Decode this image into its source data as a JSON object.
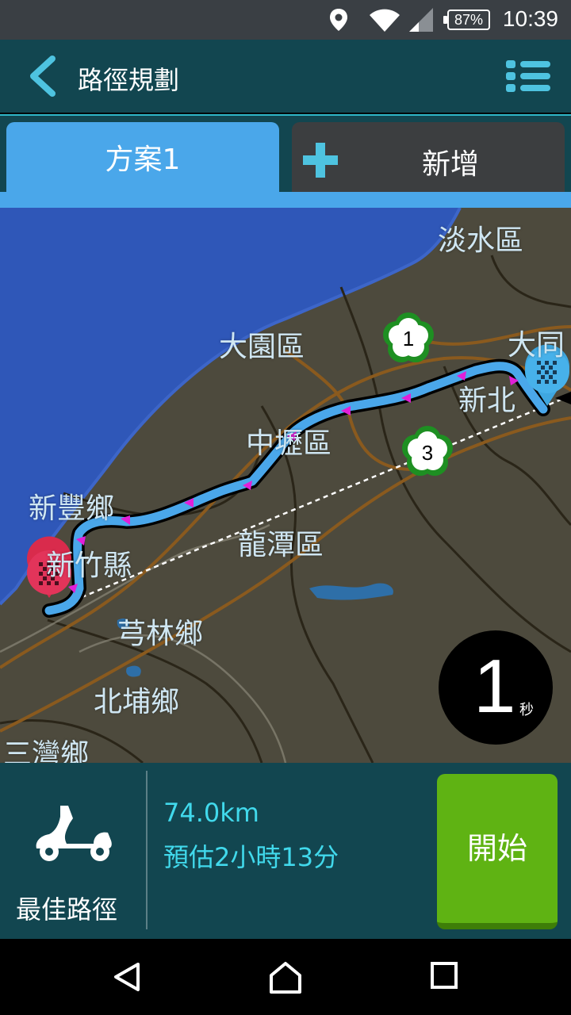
{
  "status_bar": {
    "battery": "87%",
    "time": "10:39"
  },
  "app_bar": {
    "title": "路徑規劃"
  },
  "tabs": {
    "active": "方案1",
    "add": "新增"
  },
  "map": {
    "places": [
      "淡水區",
      "大園區",
      "大同",
      "新北",
      "中壢區",
      "新豐鄉",
      "新竹縣",
      "龍潭區",
      "芎林鄉",
      "北埔鄉",
      "三灣鄉"
    ],
    "markers": [
      "1",
      "3"
    ],
    "countdown": {
      "value": "1",
      "unit": "秒"
    }
  },
  "route": {
    "type": "最佳路徑",
    "distance": "74.0km",
    "eta": "預估2小時13分",
    "start_label": "開始"
  },
  "colors": {
    "header": "#124650",
    "accent": "#41d9ec",
    "tab": "#4aa7ea",
    "start": "#5fb313",
    "route": "#4aa7ea",
    "land": "#4d4a3d",
    "sea": "#2f57b8"
  },
  "icons": [
    "location-icon",
    "wifi-icon",
    "signal-icon",
    "battery-icon",
    "back-icon",
    "list-menu-icon",
    "plus-icon",
    "scooter-icon",
    "nav-back-icon",
    "nav-home-icon",
    "nav-recents-icon"
  ]
}
